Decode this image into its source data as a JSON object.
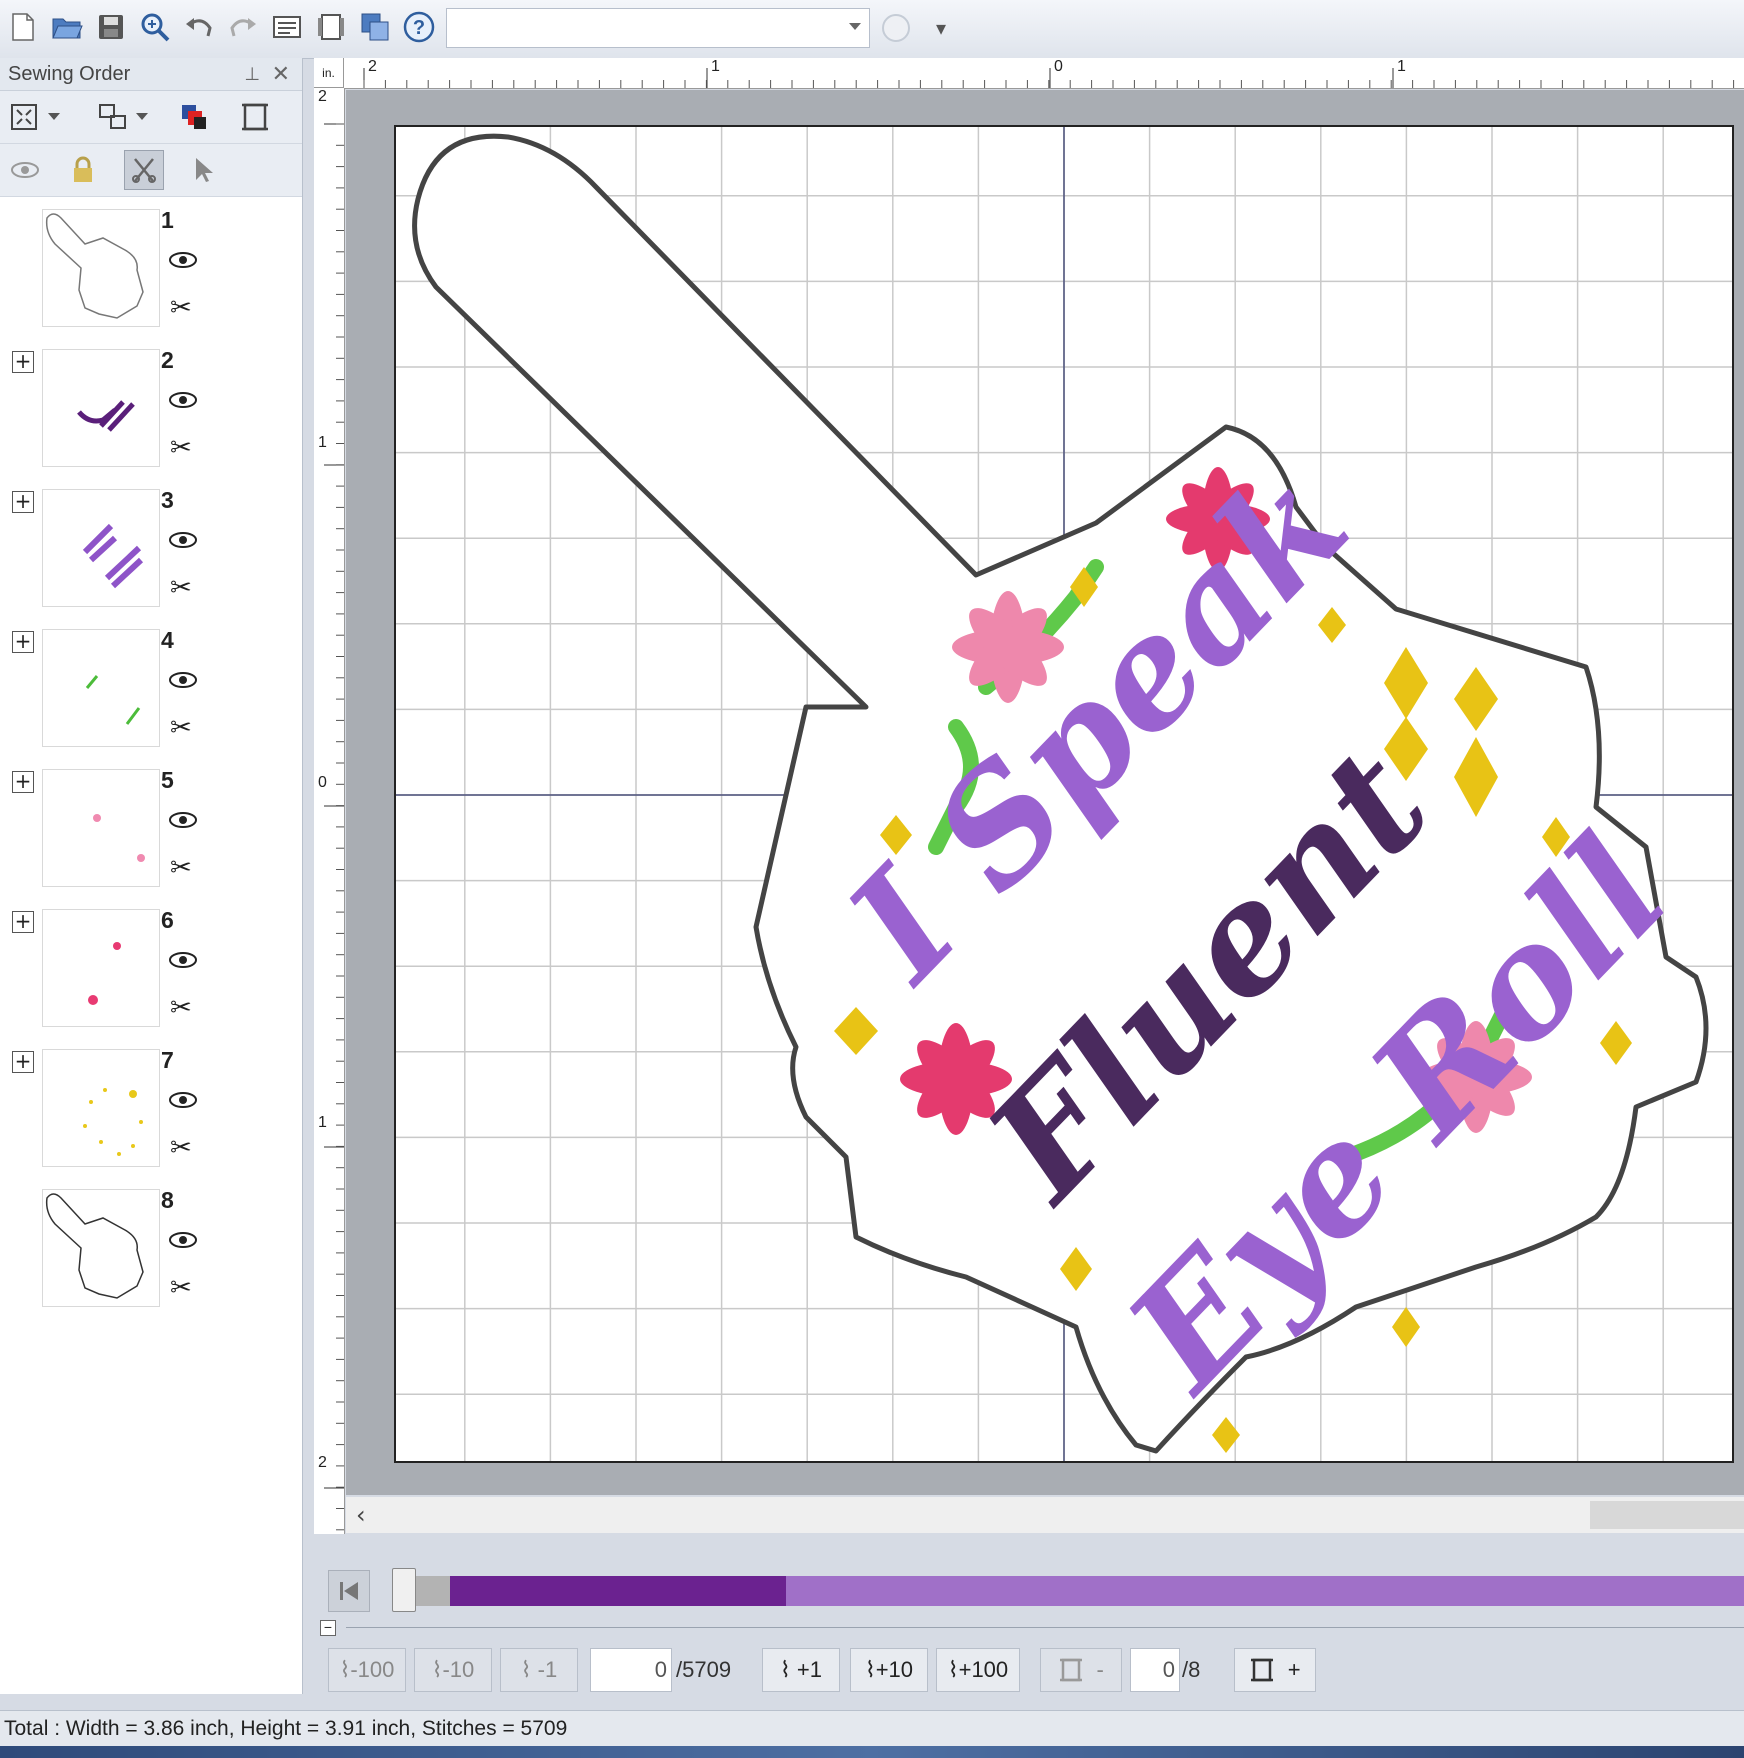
{
  "toolbar": {
    "buttons": [
      "new-icon",
      "open-icon",
      "save-icon",
      "zoom-icon",
      "undo-icon",
      "redo-icon",
      "view-icon",
      "page-icon",
      "import-icon",
      "help-icon"
    ],
    "combo_value": ""
  },
  "panel": {
    "title": "Sewing Order",
    "pin": "📌",
    "close": "✕",
    "items": [
      {
        "num": "1",
        "expandable": false,
        "color": "#777777"
      },
      {
        "num": "2",
        "expandable": true,
        "color": "#5a1f7a"
      },
      {
        "num": "3",
        "expandable": true,
        "color": "#8e54c8"
      },
      {
        "num": "4",
        "expandable": true,
        "color": "#4cbc3a"
      },
      {
        "num": "5",
        "expandable": true,
        "color": "#f08ab0"
      },
      {
        "num": "6",
        "expandable": true,
        "color": "#e83a72"
      },
      {
        "num": "7",
        "expandable": true,
        "color": "#e8c81a"
      },
      {
        "num": "8",
        "expandable": false,
        "color": "#555555"
      }
    ]
  },
  "ruler": {
    "unit": "in.",
    "h_labels": [
      "2",
      "1",
      "0",
      "1"
    ],
    "v_labels": [
      "2",
      "1",
      "0",
      "1",
      "2"
    ]
  },
  "design": {
    "text_line1": "I Speak",
    "text_line2": "Fluent",
    "text_line3": "Eye Roll"
  },
  "player": {
    "progress": 0.0,
    "color_done_fraction": 0.29
  },
  "stepbar": {
    "minus100": "-100",
    "minus10": "-10",
    "minus1": "-1",
    "stitch_value": "0",
    "stitch_total": "/5709",
    "plus1": "+1",
    "plus10": "+10",
    "plus100": "+100",
    "color_minus": "-",
    "color_value": "0",
    "color_total": "/8",
    "color_plus": "+"
  },
  "status": {
    "text": "Total : Width = 3.86 inch, Height = 3.91 inch, Stitches = 5709"
  },
  "colors": {
    "dark_purple": "#4a2a5e",
    "purple": "#9a62d0",
    "pink": "#ee88ac",
    "magenta": "#e43a6e",
    "green": "#5fc94a",
    "yellow": "#e8c315"
  }
}
